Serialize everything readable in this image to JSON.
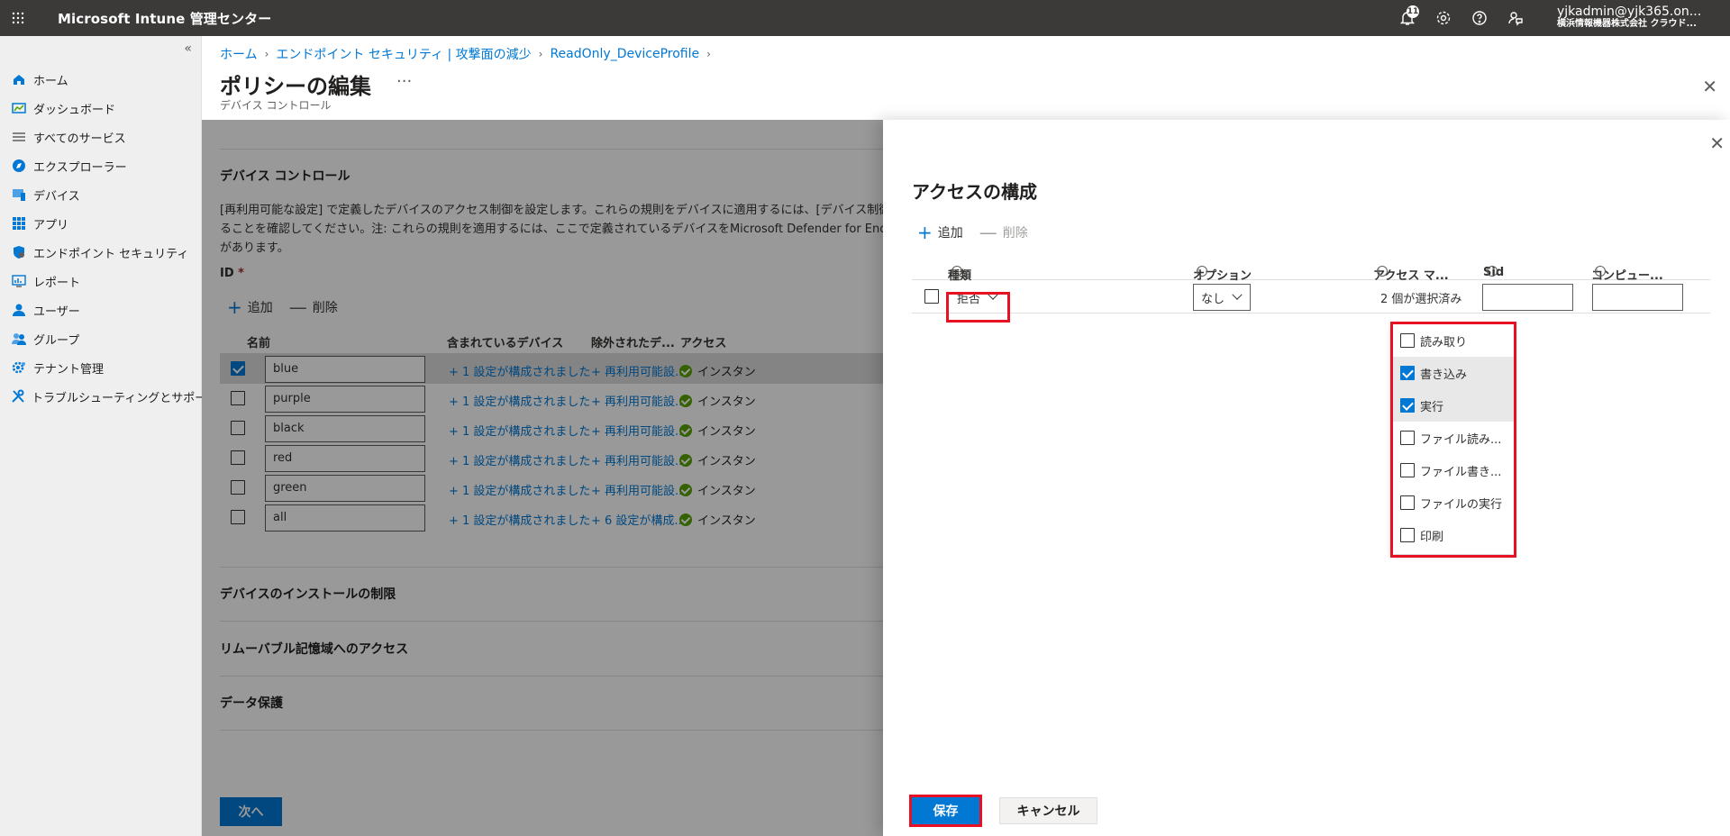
{
  "topbar": {
    "brand": "Microsoft Intune 管理センター",
    "notification_count": "11",
    "account_email": "yjkadmin@yjk365.on...",
    "account_tenant": "横浜情報機器株式会社 クラウド..."
  },
  "sidebar": {
    "items": [
      {
        "label": "ホーム",
        "icon": "home-icon"
      },
      {
        "label": "ダッシュボード",
        "icon": "dashboard-icon"
      },
      {
        "label": "すべてのサービス",
        "icon": "list-icon"
      },
      {
        "label": "エクスプローラー",
        "icon": "explorer-icon"
      },
      {
        "label": "デバイス",
        "icon": "device-icon"
      },
      {
        "label": "アプリ",
        "icon": "apps-icon"
      },
      {
        "label": "エンドポイント セキュリティ",
        "icon": "shield-icon"
      },
      {
        "label": "レポート",
        "icon": "report-icon"
      },
      {
        "label": "ユーザー",
        "icon": "user-icon"
      },
      {
        "label": "グループ",
        "icon": "group-icon"
      },
      {
        "label": "テナント管理",
        "icon": "tenant-gear-icon"
      },
      {
        "label": "トラブルシューティングとサポート",
        "icon": "wrench-icon"
      }
    ]
  },
  "breadcrumb": [
    "ホーム",
    "エンドポイント セキュリティ | 攻撃面の減少",
    "ReadOnly_DeviceProfile"
  ],
  "page": {
    "title": "ポリシーの編集",
    "subtitle": "デバイス コントロール"
  },
  "main": {
    "section_title": "デバイス コントロール",
    "description": "[再利用可能な設定] で定義したデバイスのアクセス制御を設定します。これらの規則をデバイスに適用するには、[デバイス制御が有効] 設定がアクティブになっていることを確認してください。注: これらの規則を適用するには、ここで定義されているデバイスをMicrosoft Defender for Endpoint (MDE) にオンボードする必要があります。",
    "id_label": "ID",
    "id_required": "*",
    "add_label": "追加",
    "delete_label": "削除",
    "columns": [
      "名前",
      "含まれているデバイス",
      "除外されたデ...",
      "アクセス"
    ],
    "rows": [
      {
        "name": "blue",
        "included": "+ 1 設定が構成されました",
        "excluded": "+ 再利用可能設...",
        "access": "インスタン",
        "checked": true
      },
      {
        "name": "purple",
        "included": "+ 1 設定が構成されました",
        "excluded": "+ 再利用可能設...",
        "access": "インスタン",
        "checked": false
      },
      {
        "name": "black",
        "included": "+ 1 設定が構成されました",
        "excluded": "+ 再利用可能設...",
        "access": "インスタン",
        "checked": false
      },
      {
        "name": "red",
        "included": "+ 1 設定が構成されました",
        "excluded": "+ 再利用可能設...",
        "access": "インスタン",
        "checked": false
      },
      {
        "name": "green",
        "included": "+ 1 設定が構成されました",
        "excluded": "+ 再利用可能設...",
        "access": "インスタン",
        "checked": false
      },
      {
        "name": "all",
        "included": "+ 1 設定が構成されました",
        "excluded": "+ 6 設定が構成...",
        "access": "インスタン",
        "checked": false
      }
    ],
    "sections": [
      "デバイスのインストールの制限",
      "リムーバブル記憶域へのアクセス",
      "データ保護"
    ],
    "next_label": "次へ"
  },
  "flyout": {
    "title": "アクセスの構成",
    "add_label": "追加",
    "delete_label": "削除",
    "columns": [
      "種類",
      "オプション",
      "アクセス マ...",
      "Sid",
      "コンピュー..."
    ],
    "row": {
      "type_value": "拒否",
      "option_value": "なし",
      "access_mask_value": "2 個が選択済み"
    },
    "access_options": [
      {
        "label": "読み取り",
        "checked": false
      },
      {
        "label": "書き込み",
        "checked": true
      },
      {
        "label": "実行",
        "checked": true
      },
      {
        "label": "ファイル読み...",
        "checked": false
      },
      {
        "label": "ファイル書き...",
        "checked": false
      },
      {
        "label": "ファイルの実行",
        "checked": false
      },
      {
        "label": "印刷",
        "checked": false
      }
    ],
    "save_label": "保存",
    "cancel_label": "キャンセル"
  },
  "colors": {
    "accent": "#0078d4",
    "highlight_box": "#e81123",
    "topbar": "#3b3a39",
    "success": "#57a300"
  }
}
